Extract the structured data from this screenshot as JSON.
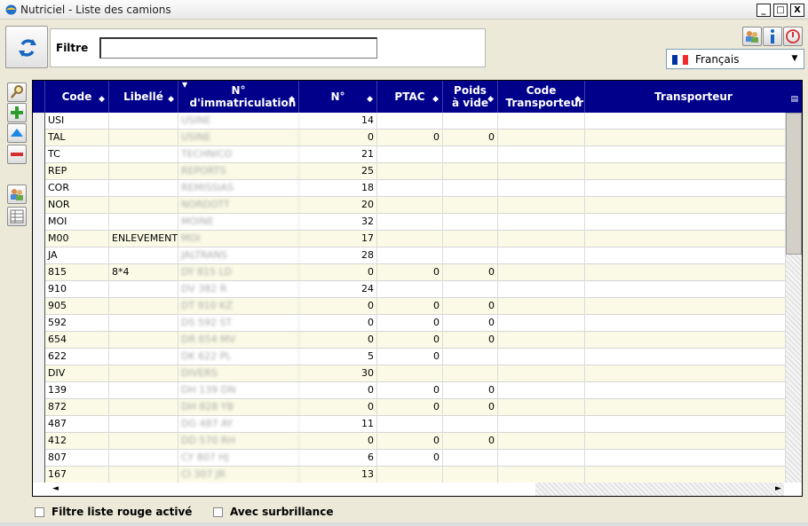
{
  "window": {
    "title": "Nutriciel - Liste des camions",
    "minimize": "_",
    "maximize": "□",
    "close": "X"
  },
  "filter": {
    "label": "Filtre",
    "value": ""
  },
  "language": {
    "selected": "Français",
    "flag_colors": [
      "#0033a0",
      "#ffffff",
      "#ef2b2d"
    ]
  },
  "grid": {
    "columns": [
      "Code",
      "Libellé",
      "N° d'immatriculation",
      "N°",
      "PTAC",
      "Poids à vide",
      "Code Transporteur",
      "Transporteur"
    ],
    "rows": [
      {
        "code": "USI",
        "libelle": "",
        "immat": "USINE",
        "num": "14",
        "ptac": "",
        "poids": "",
        "ctrans": "",
        "trans": ""
      },
      {
        "code": "TAL",
        "libelle": "",
        "immat": "USINE",
        "num": "0",
        "ptac": "0",
        "poids": "0",
        "ctrans": "",
        "trans": ""
      },
      {
        "code": "TC",
        "libelle": "",
        "immat": "TECHNICO",
        "num": "21",
        "ptac": "",
        "poids": "",
        "ctrans": "",
        "trans": ""
      },
      {
        "code": "REP",
        "libelle": "",
        "immat": "REPORTS",
        "num": "25",
        "ptac": "",
        "poids": "",
        "ctrans": "",
        "trans": ""
      },
      {
        "code": "COR",
        "libelle": "",
        "immat": "REMISSIAS",
        "num": "18",
        "ptac": "",
        "poids": "",
        "ctrans": "",
        "trans": ""
      },
      {
        "code": "NOR",
        "libelle": "",
        "immat": "NORDOTT",
        "num": "20",
        "ptac": "",
        "poids": "",
        "ctrans": "",
        "trans": ""
      },
      {
        "code": "MOI",
        "libelle": "",
        "immat": "MOINE",
        "num": "32",
        "ptac": "",
        "poids": "",
        "ctrans": "",
        "trans": ""
      },
      {
        "code": "M00",
        "libelle": "ENLEVEMENT",
        "immat": "MOI",
        "num": "17",
        "ptac": "",
        "poids": "",
        "ctrans": "",
        "trans": ""
      },
      {
        "code": "JA",
        "libelle": "",
        "immat": "JALTRANS",
        "num": "28",
        "ptac": "",
        "poids": "",
        "ctrans": "",
        "trans": ""
      },
      {
        "code": "815",
        "libelle": "8*4",
        "immat": "DY 815 LD",
        "num": "0",
        "ptac": "0",
        "poids": "0",
        "ctrans": "",
        "trans": ""
      },
      {
        "code": "910",
        "libelle": "",
        "immat": "DV 382 R",
        "num": "24",
        "ptac": "",
        "poids": "",
        "ctrans": "",
        "trans": ""
      },
      {
        "code": "905",
        "libelle": "",
        "immat": "DT 910 KZ",
        "num": "0",
        "ptac": "0",
        "poids": "0",
        "ctrans": "",
        "trans": ""
      },
      {
        "code": "592",
        "libelle": "",
        "immat": "DS 592 ST",
        "num": "0",
        "ptac": "0",
        "poids": "0",
        "ctrans": "",
        "trans": ""
      },
      {
        "code": "654",
        "libelle": "",
        "immat": "DR 654 MV",
        "num": "0",
        "ptac": "0",
        "poids": "0",
        "ctrans": "",
        "trans": ""
      },
      {
        "code": "622",
        "libelle": "",
        "immat": "DK 622 PL",
        "num": "5",
        "ptac": "0",
        "poids": "",
        "ctrans": "",
        "trans": ""
      },
      {
        "code": "DIV",
        "libelle": "",
        "immat": "DIVERS",
        "num": "30",
        "ptac": "",
        "poids": "",
        "ctrans": "",
        "trans": ""
      },
      {
        "code": "139",
        "libelle": "",
        "immat": "DH 139 DN",
        "num": "0",
        "ptac": "0",
        "poids": "0",
        "ctrans": "",
        "trans": ""
      },
      {
        "code": "872",
        "libelle": "",
        "immat": "DH 828 YB",
        "num": "0",
        "ptac": "0",
        "poids": "0",
        "ctrans": "",
        "trans": ""
      },
      {
        "code": "487",
        "libelle": "",
        "immat": "DG 487 AY",
        "num": "11",
        "ptac": "",
        "poids": "",
        "ctrans": "",
        "trans": ""
      },
      {
        "code": "412",
        "libelle": "",
        "immat": "DD 570 RH",
        "num": "0",
        "ptac": "0",
        "poids": "0",
        "ctrans": "",
        "trans": ""
      },
      {
        "code": "807",
        "libelle": "",
        "immat": "CY 807 HJ",
        "num": "6",
        "ptac": "0",
        "poids": "",
        "ctrans": "",
        "trans": ""
      },
      {
        "code": "167",
        "libelle": "",
        "immat": "CI 307 JR",
        "num": "13",
        "ptac": "",
        "poids": "",
        "ctrans": "",
        "trans": ""
      }
    ]
  },
  "options": {
    "red_list": "Filtre liste rouge activé",
    "highlight": "Avec surbrillance"
  },
  "icons": {
    "refresh": "refresh-icon",
    "users": "users-icon",
    "info": "info-icon",
    "power": "power-icon",
    "search": "search-icon",
    "add": "add-icon",
    "up": "move-up-icon",
    "remove": "remove-icon",
    "people": "people-icon",
    "grid": "grid-icon"
  }
}
